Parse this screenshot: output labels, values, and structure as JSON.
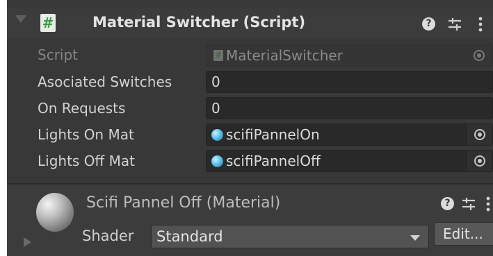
{
  "component": {
    "title": "Material Switcher (Script)",
    "icon": "csharp-script-icon",
    "header_icons": [
      "help-icon",
      "presets-icon",
      "kebab-menu-icon"
    ]
  },
  "fields": {
    "script": {
      "label": "Script",
      "value": "MaterialSwitcher",
      "icon": "script-icon"
    },
    "associated_switches": {
      "label": "Asociated Switches",
      "value": "0"
    },
    "on_requests": {
      "label": "On Requests",
      "value": "0"
    },
    "lights_on_mat": {
      "label": "Lights On Mat",
      "value": "scifiPannelOn",
      "icon": "material-icon"
    },
    "lights_off_mat": {
      "label": "Lights Off Mat",
      "value": "scifiPannelOff",
      "icon": "material-icon"
    }
  },
  "material": {
    "title": "Scifi Pannel Off (Material)",
    "shader_label": "Shader",
    "shader_value": "Standard",
    "edit_label": "Edit..."
  },
  "colors": {
    "panel_bg": "#383838",
    "field_bg": "#292929",
    "text": "#d2d2d2",
    "material_icon": "#5cc3ef",
    "script_hash": "#3d9a45"
  }
}
